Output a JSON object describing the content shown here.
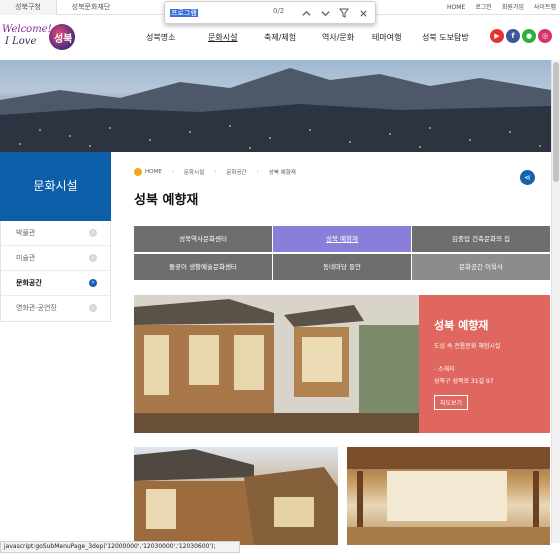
{
  "topbar": {
    "tabs": [
      "성북구청",
      "성북문화재단"
    ],
    "links": [
      "HOME",
      "로그인",
      "회원가입",
      "사이트맵"
    ]
  },
  "findbar": {
    "query": "프로그램",
    "count": "0/2"
  },
  "logo": {
    "line1": "Welcome!",
    "line2": "I Love",
    "mark": "성북"
  },
  "gnb": [
    "성북명소",
    "문화시설",
    "축제/체험",
    "역사/문화",
    "테마여행",
    "성북 도보탐방"
  ],
  "sidebar": {
    "title": "문화시설",
    "items": [
      {
        "label": "박물관"
      },
      {
        "label": "미술관"
      },
      {
        "label": "문화공간"
      },
      {
        "label": "영화관·공연장"
      }
    ]
  },
  "breadcrumb": [
    "HOME",
    "문화시설",
    "문화공간",
    "성북 예향재"
  ],
  "page_title": "성북 예향재",
  "tabs": [
    "성북역사문화센터",
    "성북 예향재",
    "김중업 건축문화의 집",
    "돌곶이 생활예술문화센터",
    "동네마당 들안",
    "문화공간 이육사"
  ],
  "feature": {
    "title": "성북 예향재",
    "subtitle": "도심 속 전통문화 체험시설",
    "address_label": "- 소재지",
    "address": "성북구 성북로 31길 97",
    "map_button": "지도보기"
  },
  "status_url": "javascript:goSubMenuPage_3dep('12000000','12030000','12030600');",
  "colors": {
    "sidebar_head": "#0d5ea8",
    "active_tab": "#8a7fd8",
    "feature_panel": "#e0675f"
  }
}
